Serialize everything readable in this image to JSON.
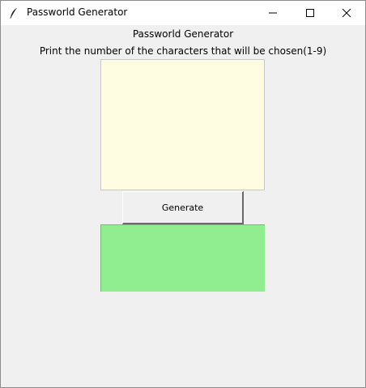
{
  "window": {
    "title": "Passworld Generator",
    "icon": "feather-icon",
    "controls": {
      "minimize_icon": "minimize-icon",
      "maximize_icon": "maximize-icon",
      "close_icon": "close-icon"
    }
  },
  "main": {
    "heading": "Passworld Generator",
    "instruction": "Print the number of the characters that will be chosen(1-9)",
    "input_value": "",
    "generate_label": "Generate",
    "result_text": ""
  },
  "colors": {
    "input_background": "#fffde1",
    "result_background": "#90ee90",
    "window_background": "#f0f0f0"
  }
}
